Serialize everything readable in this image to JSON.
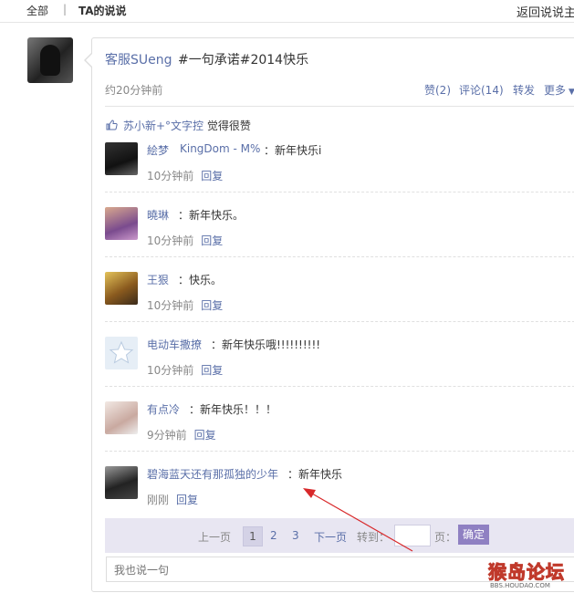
{
  "topbar": {
    "tab_all": "全部",
    "separator": "|",
    "tab_ta": "TA的说说",
    "back_link": "返回说说主"
  },
  "post": {
    "author": "客服SUeng",
    "text": "#一句承诺#2014快乐",
    "time": "约20分钟前",
    "actions": {
      "like": "赞(2)",
      "comment": "评论(14)",
      "share": "转发",
      "more": "更多"
    }
  },
  "likes": {
    "names": "苏小新+°文字控",
    "suffix": "觉得很赞"
  },
  "comments": [
    {
      "author": "絵梦",
      "extra": "KingDom - M%",
      "text": "：新年快乐i",
      "time": "10分钟前",
      "reply": "回复"
    },
    {
      "author": "曉琳",
      "text": "：新年快乐。",
      "time": "10分钟前",
      "reply": "回复"
    },
    {
      "author": "王狠",
      "text": "：快乐。",
      "time": "10分钟前",
      "reply": "回复"
    },
    {
      "author": "电动车撒撩",
      "text": "：新年快乐哦!!!!!!!!!!",
      "time": "10分钟前",
      "reply": "回复"
    },
    {
      "author": "有点冷",
      "text": "：新年快乐！！！",
      "time": "9分钟前",
      "reply": "回复"
    },
    {
      "author": "碧海蓝天还有那孤独的少年",
      "text": "：新年快乐",
      "time": "刚刚",
      "reply": "回复"
    }
  ],
  "pager": {
    "prev": "上一页",
    "pages": [
      "1",
      "2",
      "3"
    ],
    "next": "下一页",
    "goto": "转到：",
    "page_suffix": "页：",
    "confirm": "确定"
  },
  "reply_box": {
    "placeholder": "我也说一句"
  },
  "watermark": {
    "logo_text": "猴岛论坛",
    "url": "BBS.HOUDAO.COM"
  },
  "colors": {
    "link": "#5a6fa8",
    "pager_bg": "#e8e6f2",
    "confirm_bg": "#8f80c2",
    "annotation_arrow": "#d8282a"
  }
}
